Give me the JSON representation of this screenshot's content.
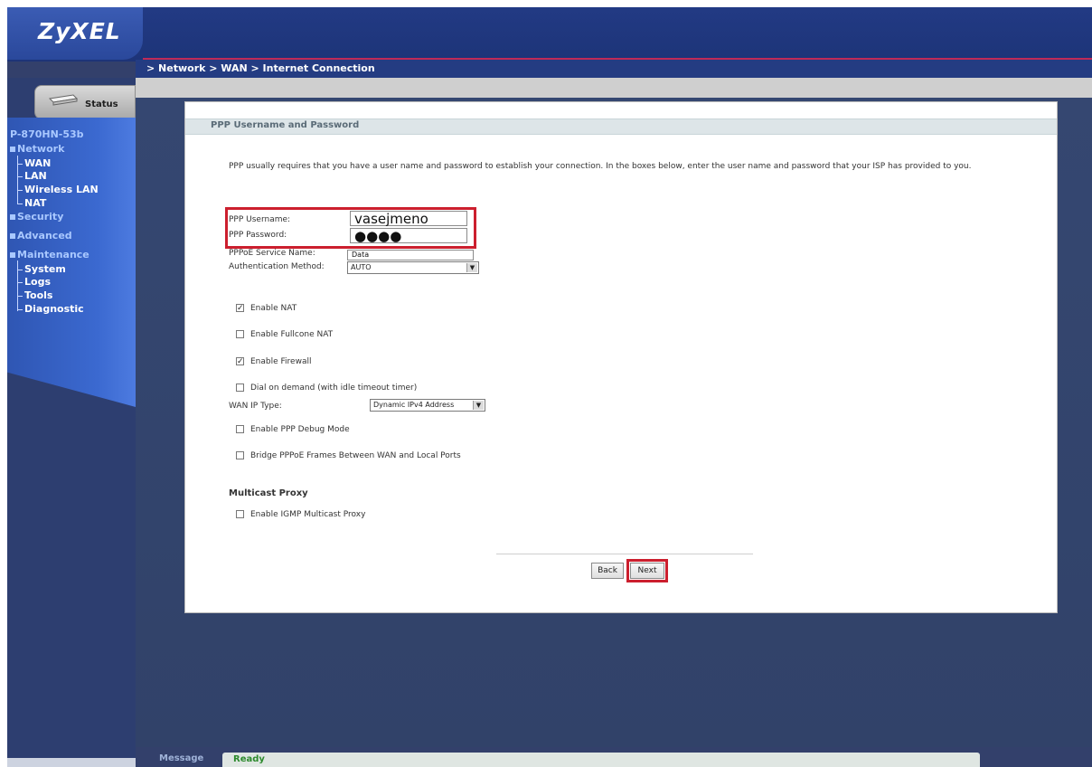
{
  "brand": {
    "logo": "ZyXEL"
  },
  "breadcrumb": "> Network > WAN > Internet Connection",
  "sidebar": {
    "status_label": "Status",
    "model": "P-870HN-53b",
    "network": "Network",
    "wan": "WAN",
    "lan": "LAN",
    "wireless_lan": "Wireless LAN",
    "nat": "NAT",
    "security": "Security",
    "advanced": "Advanced",
    "maintenance": "Maintenance",
    "system": "System",
    "logs": "Logs",
    "tools": "Tools",
    "diagnostic": "Diagnostic"
  },
  "panel": {
    "title": "PPP Username and Password",
    "description": "PPP usually requires that you have a user name and password to establish your connection. In the boxes below, enter the user name and password that your ISP has provided to you."
  },
  "form": {
    "username_label": "PPP Username:",
    "username_value": "vasejmeno",
    "password_label": "PPP Password:",
    "password_value": "●●●●",
    "service_label": "PPPoE Service Name:",
    "service_value": "Data",
    "auth_label": "Authentication Method:",
    "auth_value": "AUTO",
    "enable_nat": "Enable NAT",
    "enable_fullcone": "Enable Fullcone NAT",
    "enable_firewall": "Enable Firewall",
    "dial_on_demand": "Dial on demand (with idle timeout timer)",
    "wan_ip_label": "WAN IP Type:",
    "wan_ip_value": "Dynamic IPv4 Address",
    "ppp_debug": "Enable PPP Debug Mode",
    "bridge": "Bridge PPPoE Frames Between WAN and Local Ports",
    "multicast_title": "Multicast Proxy",
    "igmp": "Enable IGMP Multicast Proxy",
    "check_mark": "✓"
  },
  "buttons": {
    "back": "Back",
    "next": "Next"
  },
  "status_bar": {
    "message_label": "Message",
    "message": "Ready"
  },
  "colors": {
    "accent_red": "#cc1f2e",
    "nav_blue": "#3b69d0",
    "header_blue": "#1d3478"
  }
}
